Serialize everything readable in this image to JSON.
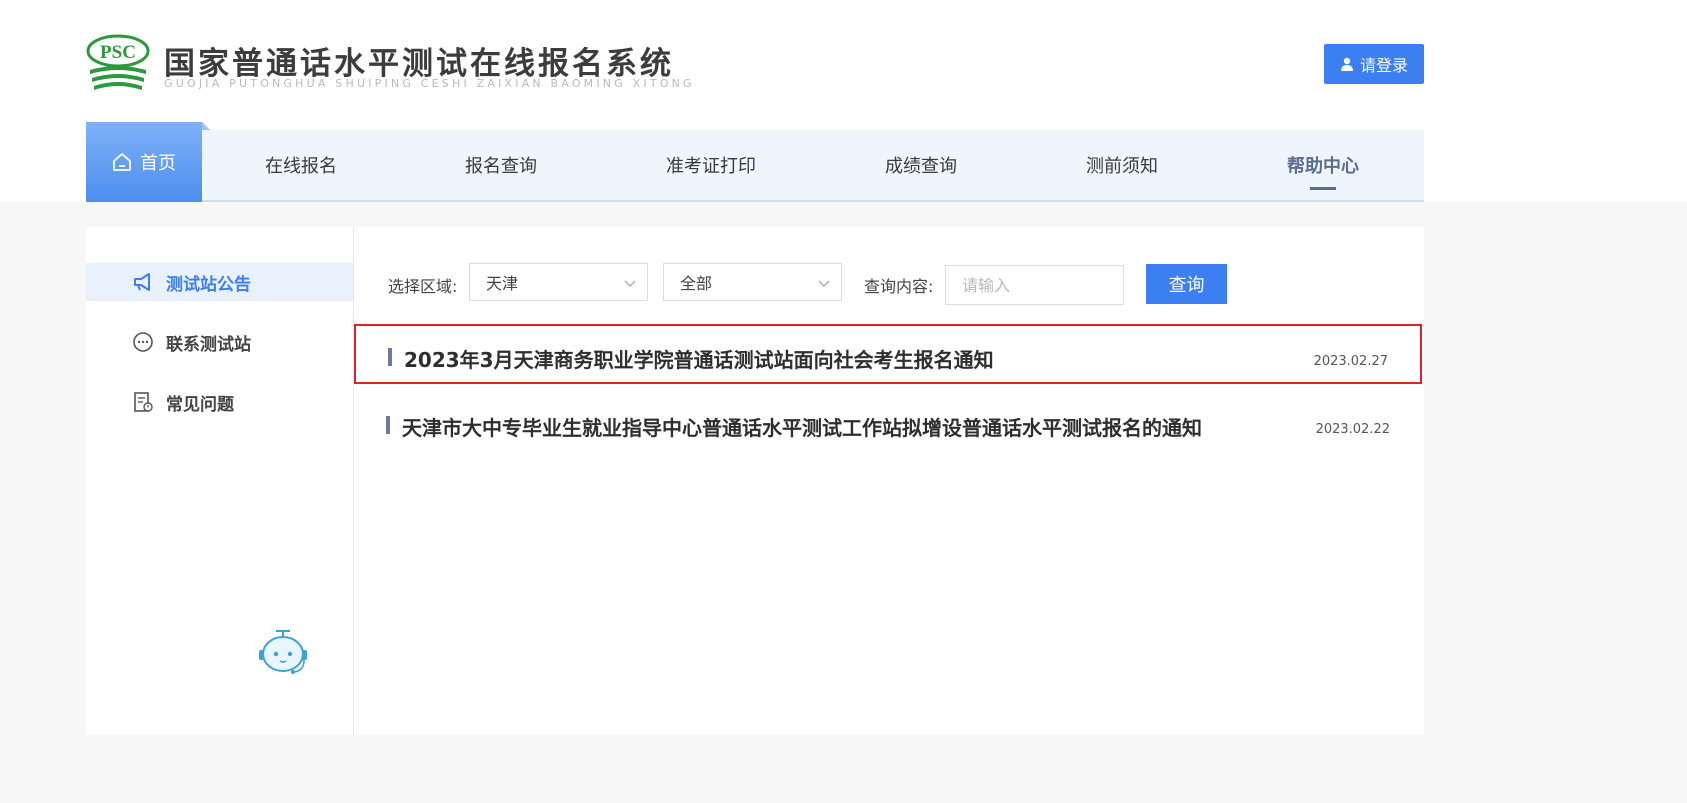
{
  "header": {
    "logo_text": "PSC",
    "title": "国家普通话水平测试在线报名系统",
    "subtitle": "GUOJIA PUTONGHUA SHUIPING CESHI ZAIXIAN BAOMING XITONG",
    "login_label": "请登录",
    "login_icon": "user-icon",
    "brand_color": "#3b7ff2",
    "logo_color": "#2a9a3c"
  },
  "nav": {
    "home_label": "首页",
    "home_icon": "home-icon",
    "items": [
      {
        "label": "在线报名"
      },
      {
        "label": "报名查询"
      },
      {
        "label": "准考证打印"
      },
      {
        "label": "成绩查询"
      },
      {
        "label": "测前须知"
      },
      {
        "label": "帮助中心",
        "active": true
      }
    ]
  },
  "sidebar": {
    "items": [
      {
        "label": "测试站公告",
        "icon": "megaphone-icon",
        "active": true
      },
      {
        "label": "联系测试站",
        "icon": "chat-bubble-icon"
      },
      {
        "label": "常见问题",
        "icon": "faq-document-icon"
      }
    ],
    "assistant_icon": "robot-assistant-icon"
  },
  "filters": {
    "region_label": "选择区域:",
    "region_value": "天津",
    "category_value": "全部",
    "query_label": "查询内容:",
    "query_placeholder": "请输入",
    "query_button": "查询"
  },
  "notices": [
    {
      "title": "2023年3月天津商务职业学院普通话测试站面向社会考生报名通知",
      "date": "2023.02.27",
      "highlighted": true
    },
    {
      "title": "天津市大中专毕业生就业指导中心普通话水平测试工作站拟增设普通话水平测试报名的通知",
      "date": "2023.02.22",
      "highlighted": false
    }
  ]
}
